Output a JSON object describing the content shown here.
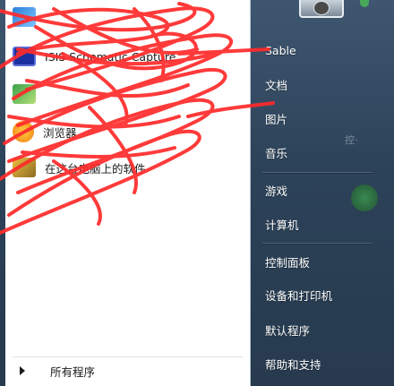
{
  "programs": [
    {
      "label": "",
      "icon": "program-icon"
    },
    {
      "label": "ISIS Schematic Capture",
      "icon": "isis-icon"
    },
    {
      "label": "",
      "icon": "program-icon"
    },
    {
      "label": "浏览器",
      "icon": "browser-icon"
    },
    {
      "label": "在这台电脑上的软件",
      "icon": "install-icon"
    }
  ],
  "all_programs": "所有程序",
  "right_menu": [
    "Sable",
    "文档",
    "图片",
    "音乐",
    "游戏",
    "计算机",
    "控制面板",
    "设备和打印机",
    "默认程序",
    "帮助和支持"
  ],
  "background_text": "控·",
  "colors": {
    "scribble": "#ff2a2a",
    "pane_bg": "#ffffff",
    "right_bg": "#2c4258"
  }
}
